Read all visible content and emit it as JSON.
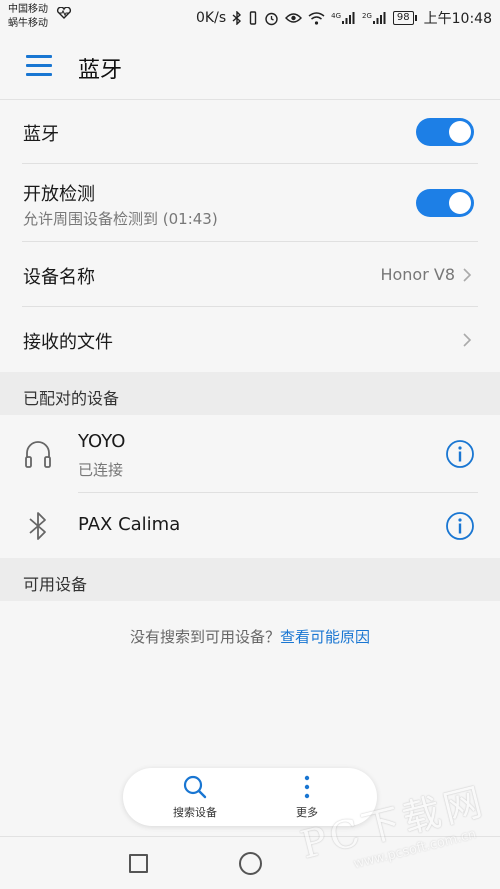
{
  "status_bar": {
    "carrier_1": "中国移动",
    "carrier_2": "蜗牛移动",
    "net_speed": "0K/s",
    "battery": "98",
    "time": "上午10:48",
    "signal_1_label": "4G",
    "signal_2_label": "2G"
  },
  "app_bar": {
    "title": "蓝牙"
  },
  "settings": {
    "bluetooth": {
      "label": "蓝牙",
      "enabled": true
    },
    "discoverable": {
      "label": "开放检测",
      "sub": "允许周围设备检测到 (01:43)",
      "enabled": true
    },
    "device_name": {
      "label": "设备名称",
      "value": "Honor V8"
    },
    "received_files": {
      "label": "接收的文件"
    }
  },
  "paired_section": {
    "header": "已配对的设备",
    "devices": [
      {
        "name": "YOYO",
        "status": "已连接",
        "icon": "headphones-icon"
      },
      {
        "name": "PAX Calima",
        "status": "",
        "icon": "bluetooth-icon"
      }
    ]
  },
  "available_section": {
    "header": "可用设备",
    "empty_text": "没有搜索到可用设备？",
    "empty_link": "查看可能原因"
  },
  "bottom_actions": {
    "search_label": "搜索设备",
    "more_label": "更多"
  },
  "watermark": {
    "big": "PC下载网",
    "small": "www.pcsoft.com.cn"
  },
  "colors": {
    "accent": "#1d7fe6",
    "link": "#1976d2",
    "background": "#f6f6f6",
    "section_header": "#ececec"
  }
}
